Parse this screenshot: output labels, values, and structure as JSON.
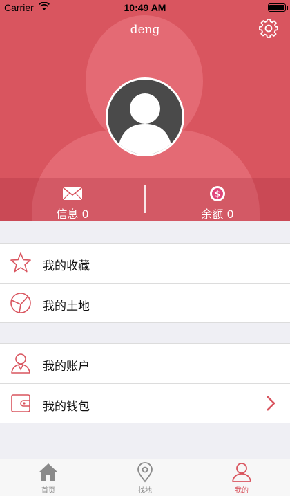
{
  "status_bar": {
    "carrier": "Carrier",
    "time": "10:49 AM"
  },
  "profile": {
    "username": "deng"
  },
  "stats": {
    "messages_label": "信息 0",
    "balance_label": "余额 0"
  },
  "menu": {
    "group1": [
      {
        "label": "我的收藏",
        "icon": "star-icon"
      },
      {
        "label": "我的土地",
        "icon": "land-icon"
      }
    ],
    "group2": [
      {
        "label": "我的账户",
        "icon": "account-icon"
      },
      {
        "label": "我的钱包",
        "icon": "wallet-icon"
      }
    ]
  },
  "tabbar": {
    "tabs": [
      {
        "label": "首页",
        "icon": "home-icon",
        "active": false
      },
      {
        "label": "找地",
        "icon": "location-pin-icon",
        "active": false
      },
      {
        "label": "我的",
        "icon": "user-icon",
        "active": true
      }
    ]
  },
  "colors": {
    "accent": "#d9555f",
    "background": "#efeff4",
    "inactive_tab": "#8a8a8a"
  }
}
